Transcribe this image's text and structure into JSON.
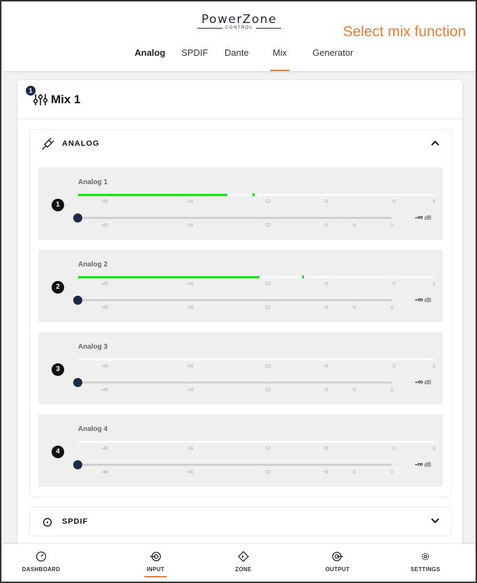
{
  "brand": {
    "name": "PowerZone",
    "sub": "CONTROL"
  },
  "annotation": "Select mix function",
  "tabs": [
    {
      "label": "Analog"
    },
    {
      "label": "SPDIF"
    },
    {
      "label": "Dante"
    },
    {
      "label": "Mix"
    },
    {
      "label": "Generator"
    }
  ],
  "selected_tab": "Mix",
  "card": {
    "badge": "1",
    "title": "Mix 1",
    "icon": "mixer-sliders-icon"
  },
  "sections": {
    "analog": {
      "label": "ANALOG",
      "icon": "cable-plug-icon",
      "expanded": true
    },
    "spdif": {
      "label": "SPDIF",
      "icon": "circle-dot-icon",
      "expanded": false
    }
  },
  "meter_ticks": [
    "-48",
    "-24",
    "-12",
    "-6",
    "0",
    "3"
  ],
  "fader_ticks": [
    "-48",
    "-24",
    "-12",
    "-6",
    "-3",
    "0"
  ],
  "channels": [
    {
      "num": "1",
      "name": "Analog 1",
      "level_fraction": 0.42,
      "peak_fraction": 0.49,
      "fader_db": "-∞",
      "unit": "dB"
    },
    {
      "num": "2",
      "name": "Analog 2",
      "level_fraction": 0.51,
      "peak_fraction": 0.63,
      "fader_db": "-∞",
      "unit": "dB"
    },
    {
      "num": "3",
      "name": "Analog 3",
      "level_fraction": 0,
      "peak_fraction": null,
      "fader_db": "-∞",
      "unit": "dB"
    },
    {
      "num": "4",
      "name": "Analog 4",
      "level_fraction": 0,
      "peak_fraction": null,
      "fader_db": "-∞",
      "unit": "dB"
    }
  ],
  "bottom_nav": [
    {
      "label": "DASHBOARD",
      "icon": "gauge-icon"
    },
    {
      "label": "INPUT",
      "icon": "input-icon"
    },
    {
      "label": "ZONE",
      "icon": "zone-icon"
    },
    {
      "label": "OUTPUT",
      "icon": "output-icon"
    },
    {
      "label": "SETTINGS",
      "icon": "gear-icon"
    }
  ],
  "active_nav": "INPUT",
  "colors": {
    "accent": "#ee7a30",
    "meter": "#22dd22",
    "knob": "#1c2b4a"
  }
}
